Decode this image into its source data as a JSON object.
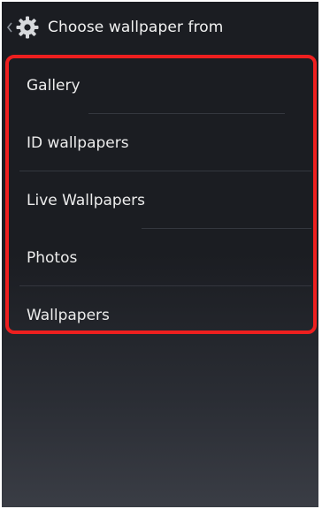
{
  "action_bar": {
    "title": "Choose wallpaper from",
    "icon": "settings-gear-icon",
    "up_icon": "chevron-left-icon"
  },
  "list": {
    "items": [
      {
        "label": "Gallery"
      },
      {
        "label": "ID wallpapers"
      },
      {
        "label": "Live Wallpapers"
      },
      {
        "label": "Photos"
      },
      {
        "label": "Wallpapers"
      }
    ]
  },
  "colors": {
    "background": "#1b1d22",
    "text": "#ececec",
    "divider": "#34373e",
    "highlight": "#ee1f1f"
  }
}
